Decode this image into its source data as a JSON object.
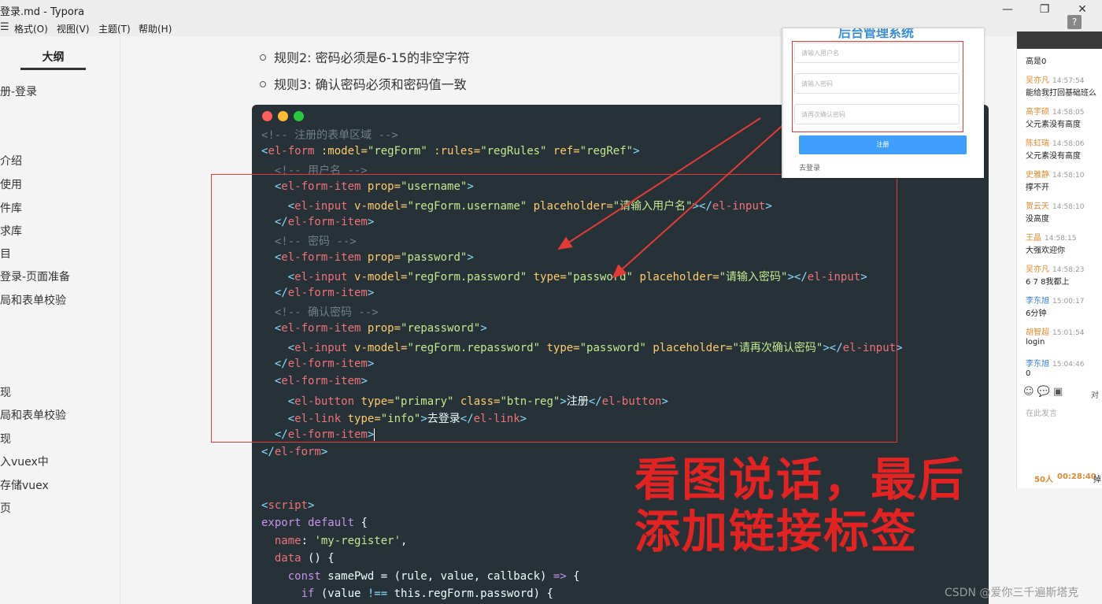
{
  "window": {
    "title": "登录.md - Typora",
    "min_glyph": "—",
    "max_glyph": "❐",
    "close_glyph": "✕"
  },
  "menu": {
    "items": [
      "格式(O)",
      "视图(V)",
      "主题(T)",
      "帮助(H)"
    ]
  },
  "sidebar": {
    "tab": "大纲",
    "items": [
      "册-登录",
      "介绍",
      "使用",
      "件库",
      "求库",
      "目",
      "登录-页面准备",
      "局和表单校验",
      "现",
      "局和表单校验",
      "现",
      "入vuex中",
      "存储vuex",
      "页"
    ]
  },
  "doc": {
    "rule2": "规则2: 密码必须是6-15的非空字符",
    "rule3": "规则3: 确认密码必须和密码值一致"
  },
  "code": {
    "lines": [
      {
        "parts": [
          {
            "t": "<!-- 注册的表单区域 -->",
            "c": "com"
          }
        ]
      },
      {
        "parts": [
          {
            "t": "<",
            "c": "op"
          },
          {
            "t": "el-form",
            "c": "tag"
          },
          {
            "t": " :model=",
            "c": "attr"
          },
          {
            "t": "\"regForm\"",
            "c": "str"
          },
          {
            "t": " :rules=",
            "c": "attr"
          },
          {
            "t": "\"regRules\"",
            "c": "str"
          },
          {
            "t": " ref=",
            "c": "attr"
          },
          {
            "t": "\"regRef\"",
            "c": "str"
          },
          {
            "t": ">",
            "c": "op"
          }
        ]
      },
      {
        "parts": [
          {
            "t": "  <!-- 用户名 -->",
            "c": "com"
          }
        ]
      },
      {
        "parts": [
          {
            "t": "  <",
            "c": "op"
          },
          {
            "t": "el-form-item",
            "c": "tag"
          },
          {
            "t": " prop=",
            "c": "attr"
          },
          {
            "t": "\"username\"",
            "c": "str"
          },
          {
            "t": ">",
            "c": "op"
          }
        ]
      },
      {
        "parts": [
          {
            "t": "    <",
            "c": "op"
          },
          {
            "t": "el-input",
            "c": "tag"
          },
          {
            "t": " v-model=",
            "c": "attr"
          },
          {
            "t": "\"regForm.username\"",
            "c": "str"
          },
          {
            "t": " placeholder=",
            "c": "attr"
          },
          {
            "t": "\"请输入用户名\"",
            "c": "str"
          },
          {
            "t": "></",
            "c": "op"
          },
          {
            "t": "el-input",
            "c": "tag"
          },
          {
            "t": ">",
            "c": "op"
          }
        ]
      },
      {
        "parts": [
          {
            "t": "  </",
            "c": "op"
          },
          {
            "t": "el-form-item",
            "c": "tag"
          },
          {
            "t": ">",
            "c": "op"
          }
        ]
      },
      {
        "parts": [
          {
            "t": "  <!-- 密码 -->",
            "c": "com"
          }
        ]
      },
      {
        "parts": [
          {
            "t": "  <",
            "c": "op"
          },
          {
            "t": "el-form-item",
            "c": "tag"
          },
          {
            "t": " prop=",
            "c": "attr"
          },
          {
            "t": "\"password\"",
            "c": "str"
          },
          {
            "t": ">",
            "c": "op"
          }
        ]
      },
      {
        "parts": [
          {
            "t": "    <",
            "c": "op"
          },
          {
            "t": "el-input",
            "c": "tag"
          },
          {
            "t": " v-model=",
            "c": "attr"
          },
          {
            "t": "\"regForm.password\"",
            "c": "str"
          },
          {
            "t": " type=",
            "c": "attr"
          },
          {
            "t": "\"password\"",
            "c": "str"
          },
          {
            "t": " placeholder=",
            "c": "attr"
          },
          {
            "t": "\"请输入密码\"",
            "c": "str"
          },
          {
            "t": "></",
            "c": "op"
          },
          {
            "t": "el-input",
            "c": "tag"
          },
          {
            "t": ">",
            "c": "op"
          }
        ]
      },
      {
        "parts": [
          {
            "t": "  </",
            "c": "op"
          },
          {
            "t": "el-form-item",
            "c": "tag"
          },
          {
            "t": ">",
            "c": "op"
          }
        ]
      },
      {
        "parts": [
          {
            "t": "  <!-- 确认密码 -->",
            "c": "com"
          }
        ]
      },
      {
        "parts": [
          {
            "t": "  <",
            "c": "op"
          },
          {
            "t": "el-form-item",
            "c": "tag"
          },
          {
            "t": " prop=",
            "c": "attr"
          },
          {
            "t": "\"repassword\"",
            "c": "str"
          },
          {
            "t": ">",
            "c": "op"
          }
        ]
      },
      {
        "parts": [
          {
            "t": "    <",
            "c": "op"
          },
          {
            "t": "el-input",
            "c": "tag"
          },
          {
            "t": " v-model=",
            "c": "attr"
          },
          {
            "t": "\"regForm.repassword\"",
            "c": "str"
          },
          {
            "t": " type=",
            "c": "attr"
          },
          {
            "t": "\"password\"",
            "c": "str"
          },
          {
            "t": " placeholder=",
            "c": "attr"
          },
          {
            "t": "\"请再次确认密码\"",
            "c": "str"
          },
          {
            "t": "></",
            "c": "op"
          },
          {
            "t": "el-input",
            "c": "tag"
          },
          {
            "t": ">",
            "c": "op"
          }
        ]
      },
      {
        "parts": [
          {
            "t": "  </",
            "c": "op"
          },
          {
            "t": "el-form-item",
            "c": "tag"
          },
          {
            "t": ">",
            "c": "op"
          }
        ]
      },
      {
        "parts": [
          {
            "t": "  <",
            "c": "op"
          },
          {
            "t": "el-form-item",
            "c": "tag"
          },
          {
            "t": ">",
            "c": "op"
          }
        ]
      },
      {
        "parts": [
          {
            "t": "    <",
            "c": "op"
          },
          {
            "t": "el-button",
            "c": "tag"
          },
          {
            "t": " type=",
            "c": "attr"
          },
          {
            "t": "\"primary\"",
            "c": "str"
          },
          {
            "t": " class=",
            "c": "attr"
          },
          {
            "t": "\"btn-reg\"",
            "c": "str"
          },
          {
            "t": ">",
            "c": "op"
          },
          {
            "t": "注册",
            "c": "plain"
          },
          {
            "t": "</",
            "c": "op"
          },
          {
            "t": "el-button",
            "c": "tag"
          },
          {
            "t": ">",
            "c": "op"
          }
        ]
      },
      {
        "parts": [
          {
            "t": "    <",
            "c": "op"
          },
          {
            "t": "el-link",
            "c": "tag"
          },
          {
            "t": " type=",
            "c": "attr"
          },
          {
            "t": "\"info\"",
            "c": "str"
          },
          {
            "t": ">",
            "c": "op"
          },
          {
            "t": "去登录",
            "c": "plain"
          },
          {
            "t": "</",
            "c": "op"
          },
          {
            "t": "el-link",
            "c": "tag"
          },
          {
            "t": ">",
            "c": "op"
          }
        ]
      },
      {
        "parts": [
          {
            "t": "  </",
            "c": "op"
          },
          {
            "t": "el-form-item",
            "c": "tag"
          },
          {
            "t": ">",
            "c": "op"
          }
        ],
        "cursor": true
      },
      {
        "parts": [
          {
            "t": "</",
            "c": "op"
          },
          {
            "t": "el-form",
            "c": "tag"
          },
          {
            "t": ">",
            "c": "op"
          }
        ]
      },
      {
        "parts": []
      },
      {
        "parts": []
      },
      {
        "parts": [
          {
            "t": "<",
            "c": "op"
          },
          {
            "t": "script",
            "c": "tag"
          },
          {
            "t": ">",
            "c": "op"
          }
        ]
      },
      {
        "parts": [
          {
            "t": "export default",
            "c": "kw"
          },
          {
            "t": " {",
            "c": "plain"
          }
        ]
      },
      {
        "parts": [
          {
            "t": "  name",
            "c": "tag"
          },
          {
            "t": ": ",
            "c": "plain"
          },
          {
            "t": "'my-register'",
            "c": "str"
          },
          {
            "t": ",",
            "c": "plain"
          }
        ]
      },
      {
        "parts": [
          {
            "t": "  data",
            "c": "tag"
          },
          {
            "t": " () {",
            "c": "plain"
          }
        ]
      },
      {
        "parts": [
          {
            "t": "    const",
            "c": "kw"
          },
          {
            "t": " samePwd = (rule, value, callback) ",
            "c": "plain"
          },
          {
            "t": "=>",
            "c": "kw"
          },
          {
            "t": " {",
            "c": "plain"
          }
        ]
      },
      {
        "parts": [
          {
            "t": "      if",
            "c": "kw"
          },
          {
            "t": " (value ",
            "c": "plain"
          },
          {
            "t": "!==",
            "c": "op"
          },
          {
            "t": " this.regForm.password) {",
            "c": "plain"
          }
        ]
      }
    ]
  },
  "overlay": {
    "line1": "看图说话，最后",
    "line2": "添加链接标签"
  },
  "inset": {
    "title": "后台管理系统",
    "username_placeholder": "请输入用户名",
    "password_placeholder": "请输入密码",
    "repassword_placeholder": "请再次确认密码",
    "register_button": "注册",
    "login_link": "去登录"
  },
  "chat": {
    "first_msg": "高是0",
    "messages": [
      {
        "name": "吴亦凡",
        "time": "14:57:54",
        "text": "能给我打回基础班么",
        "color": "#e08a2e"
      },
      {
        "name": "高宇硕",
        "time": "14:58:05",
        "text": "父元素没有高度",
        "color": "#e08a2e"
      },
      {
        "name": "陈虹瑞",
        "time": "14:58:06",
        "text": "父元素没有高度",
        "color": "#e08a2e"
      },
      {
        "name": "史雅静",
        "time": "14:58:10",
        "text": "撑不开",
        "color": "#e08a2e"
      },
      {
        "name": "贺云天",
        "time": "14:58:10",
        "text": "没高度",
        "color": "#e08a2e"
      },
      {
        "name": "王晶",
        "time": "14:58:15",
        "text": "大强欢迎你",
        "color": "#e08a2e"
      },
      {
        "name": "吴亦凡",
        "time": "14:58:23",
        "text": "6  7  8我都上",
        "color": "#e08a2e"
      },
      {
        "name": "李东旭",
        "time": "15:00:17",
        "text": "6分钟",
        "color": "#3a7bd5"
      },
      {
        "name": "胡智超",
        "time": "15:01:54",
        "text": "login",
        "color": "#e08a2e"
      },
      {
        "name": "李东旭",
        "time": "15:04:46",
        "text": "0",
        "color": "#3a7bd5"
      }
    ],
    "emoji_icons": "☺ 💬 ▣",
    "side_char": "对",
    "input_placeholder": "在此发言",
    "count": "50人",
    "elapsed": "00:28:40",
    "tail": "掉"
  },
  "watermark": "CSDN @爱你三千遍斯塔克"
}
